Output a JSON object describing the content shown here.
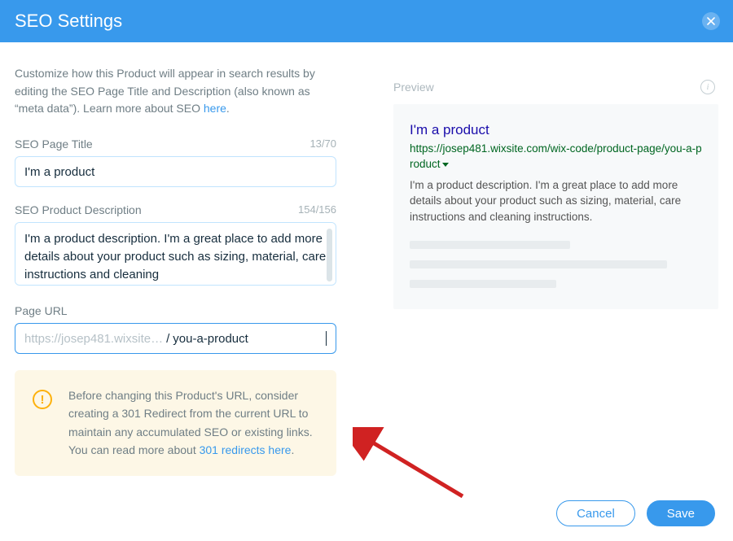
{
  "header": {
    "title": "SEO Settings"
  },
  "intro": {
    "text_before": "Customize how this Product will appear in search results by editing the SEO Page Title and Description (also known as “meta data”). Learn more about SEO ",
    "link": "here",
    "text_after": "."
  },
  "fields": {
    "title": {
      "label": "SEO Page Title",
      "counter": "13/70",
      "value": "I'm a product"
    },
    "description": {
      "label": "SEO Product Description",
      "counter": "154/156",
      "value": "I'm a product description. I'm a great place to add more details about your product such as sizing, material, care instructions and cleaning"
    },
    "url": {
      "label": "Page URL",
      "prefix": "https://josep481.wixsite…",
      "slash": "/",
      "value": "you-a-product"
    }
  },
  "warning": {
    "text_before": "Before changing this Product's URL, consider creating a 301 Redirect from the current URL to maintain any accumulated SEO or existing links. You can read more about ",
    "link": "301 redirects here",
    "text_after": "."
  },
  "preview": {
    "label": "Preview",
    "title": "I'm a product",
    "url": "https://josep481.wixsite.com/wix-code/product-page/you-a-product",
    "desc": "I'm a product description. I'm a great place to add more details about your product such as sizing, material, care instructions and cleaning instructions."
  },
  "buttons": {
    "cancel": "Cancel",
    "save": "Save"
  }
}
